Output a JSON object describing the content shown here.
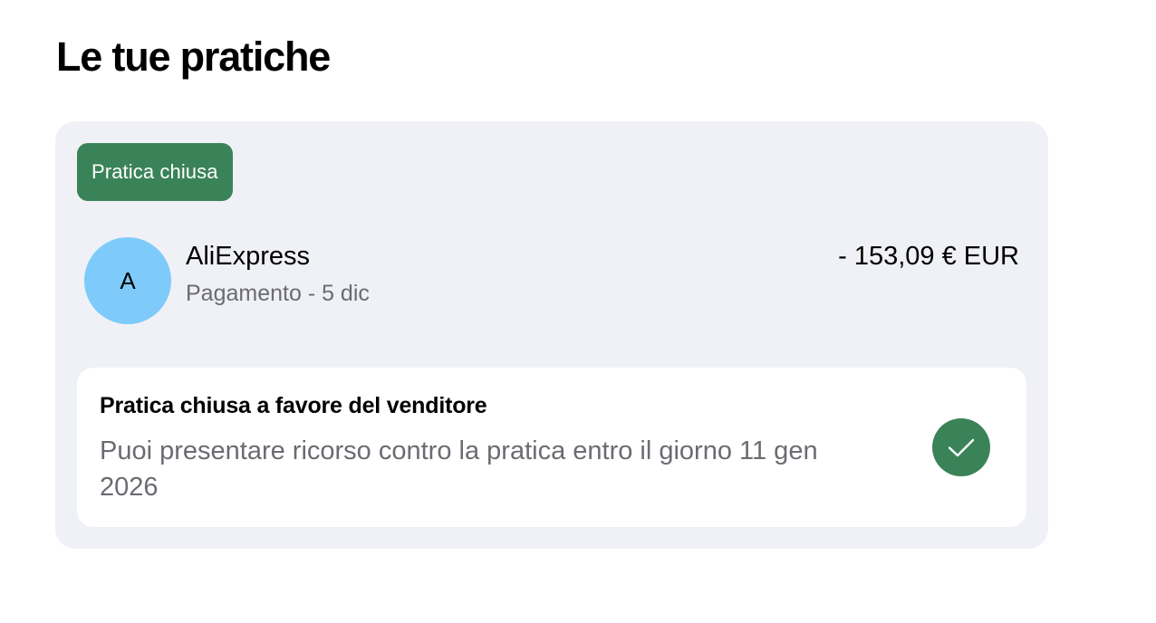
{
  "page": {
    "title": "Le tue pratiche"
  },
  "case": {
    "status_badge": "Pratica chiusa",
    "avatar_initial": "A",
    "merchant": "AliExpress",
    "meta": "Pagamento - 5 dic",
    "amount": "- 153,09 € EUR",
    "outcome": {
      "title": "Pratica chiusa a favore del venditore",
      "description": "Puoi presentare ricorso contro la pratica entro il giorno 11 gen 2026",
      "icon": "check-icon"
    }
  },
  "colors": {
    "accent_green": "#3a8358",
    "avatar_blue": "#7ecbfb",
    "card_background": "#f0f1f6",
    "secondary_text": "#6b6b72"
  }
}
